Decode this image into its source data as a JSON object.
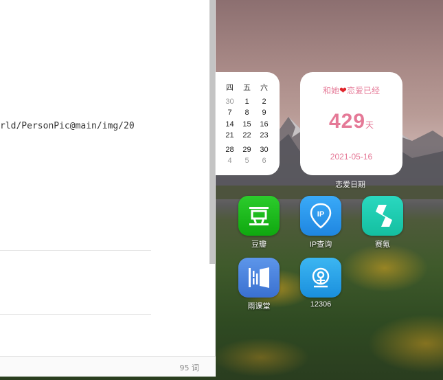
{
  "editor": {
    "code_text": "rld/PersonPic@main/img/20",
    "word_count": "95 词"
  },
  "calendar": {
    "weekdays": [
      "四",
      "五",
      "六"
    ],
    "rows": [
      [
        "30",
        "1",
        "2"
      ],
      [
        "7",
        "8",
        "9"
      ],
      [
        "14",
        "15",
        "16"
      ],
      [
        "21",
        "22",
        "23"
      ],
      [
        "28",
        "29",
        "30"
      ],
      [
        "4",
        "5",
        "6"
      ]
    ]
  },
  "love_widget": {
    "title_left": "和她",
    "title_right": "恋爱已经",
    "days": "429",
    "unit": "天",
    "date": "2021-05-16",
    "label": "恋爱日期"
  },
  "apps": [
    {
      "label": "豆瓣",
      "icon": "douban-icon",
      "color": "#1fb71f"
    },
    {
      "label": "IP查询",
      "icon": "ip-lookup-icon",
      "color": "#2a9df4"
    },
    {
      "label": "赛氪",
      "icon": "saike-icon",
      "color": "#1fcfb0"
    },
    {
      "label": "雨课堂",
      "icon": "yuketang-icon",
      "color": "#4a86e0"
    },
    {
      "label": "12306",
      "icon": "railway-12306-icon",
      "color": "#2a9be0"
    }
  ]
}
